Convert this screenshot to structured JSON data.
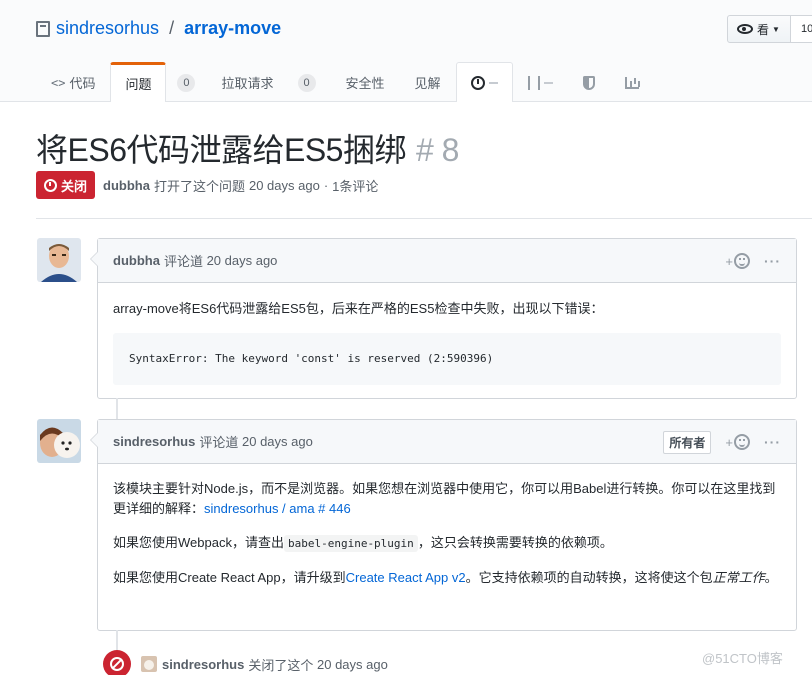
{
  "repo": {
    "owner": "sindresorhus",
    "separator": "/",
    "name": "array-move",
    "watch_label": "看",
    "watch_count": "10"
  },
  "tabs": [
    {
      "label": "代码",
      "icon": "code-icon"
    },
    {
      "label": "问题",
      "count": "0",
      "selected": true
    },
    {
      "label": "拉取请求",
      "count": "0"
    },
    {
      "label": "安全性"
    },
    {
      "label": "见解"
    }
  ],
  "issue": {
    "title": "将ES6代码泄露给ES5捆绑",
    "number": "# 8",
    "state": "关闭",
    "author": "dubbha",
    "opened_text": "打开了这个问题",
    "time": "20 days ago",
    "dot": "·",
    "comments": "1条评论"
  },
  "comments": [
    {
      "author": "dubbha",
      "verb": "评论道",
      "time": "20 days ago",
      "text": "array-move将ES6代码泄露给ES5包，后来在严格的ES5检查中失败，出现以下错误：",
      "code": "SyntaxError: The keyword 'const' is reserved (2:590396)",
      "react_plus": "+",
      "more": "···"
    },
    {
      "author": "sindresorhus",
      "verb": "评论道",
      "time": "20 days ago",
      "owner_badge": "所有者",
      "react_plus": "+",
      "more": "···",
      "p1_text": "该模块主要针对Node.js，而不是浏览器。如果您想在浏览器中使用它，你可以用Babel进行转换。你可以在这里找到更详细的解释：",
      "p1_link": "sindresorhus / ama # 446",
      "p2_pre": "如果您使用Webpack，请查出",
      "p2_code": "babel-engine-plugin",
      "p2_post": "，这只会转换需要转换的依赖项。",
      "p3_pre": "如果您使用Create React App，请升级到",
      "p3_link": "Create React App v2",
      "p3_mid": "。它支持依赖项的自动转换，这将使这个包",
      "p3_em": "正常工作",
      "p3_post": "。"
    }
  ],
  "event": {
    "author": "sindresorhus",
    "text": "关闭了这个",
    "time": "20 days ago"
  },
  "watermark": "@51CTO博客",
  "colors": {
    "link": "#0366d6",
    "closed": "#cb2431",
    "tab_accent": "#e36209"
  }
}
